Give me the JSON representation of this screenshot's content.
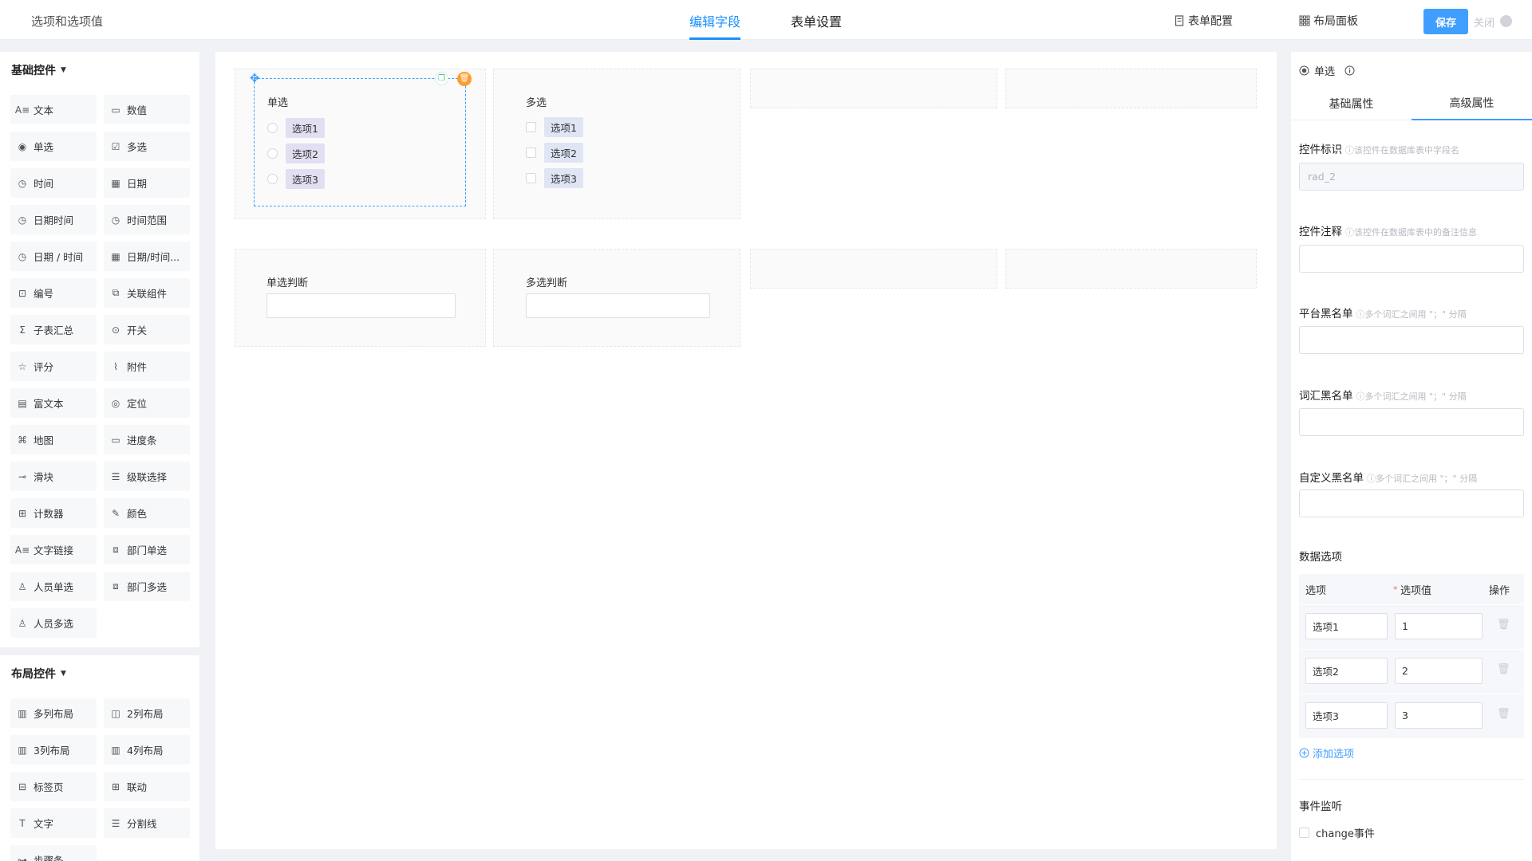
{
  "header": {
    "title": "选项和选项值",
    "tabs": [
      {
        "label": "编辑字段",
        "active": true
      },
      {
        "label": "表单设置",
        "active": false
      }
    ],
    "tools": [
      {
        "label": "表单配置",
        "icon": "form-config-icon"
      },
      {
        "label": "布局面板",
        "icon": "layout-panel-icon"
      }
    ],
    "save_label": "保存",
    "close_label": "关闭"
  },
  "left_panel": {
    "basic_group": {
      "title": "基础控件",
      "items": [
        {
          "label": "文本",
          "icon": "text-icon"
        },
        {
          "label": "数值",
          "icon": "number-icon"
        },
        {
          "label": "单选",
          "icon": "radio-icon"
        },
        {
          "label": "多选",
          "icon": "checkbox-icon"
        },
        {
          "label": "时间",
          "icon": "clock-icon"
        },
        {
          "label": "日期",
          "icon": "calendar-icon"
        },
        {
          "label": "日期时间",
          "icon": "clock-icon"
        },
        {
          "label": "时间范围",
          "icon": "clock-icon"
        },
        {
          "label": "日期 / 时间",
          "icon": "clock-icon"
        },
        {
          "label": "日期/时间...",
          "icon": "calendar-icon"
        },
        {
          "label": "编号",
          "icon": "serial-icon"
        },
        {
          "label": "关联组件",
          "icon": "link-component-icon"
        },
        {
          "label": "子表汇总",
          "icon": "sigma-icon"
        },
        {
          "label": "开关",
          "icon": "toggle-icon"
        },
        {
          "label": "评分",
          "icon": "star-icon"
        },
        {
          "label": "附件",
          "icon": "paperclip-icon"
        },
        {
          "label": "富文本",
          "icon": "rich-text-icon"
        },
        {
          "label": "定位",
          "icon": "location-icon"
        },
        {
          "label": "地图",
          "icon": "map-icon"
        },
        {
          "label": "进度条",
          "icon": "progress-icon"
        },
        {
          "label": "滑块",
          "icon": "slider-icon"
        },
        {
          "label": "级联选择",
          "icon": "cascader-icon"
        },
        {
          "label": "计数器",
          "icon": "counter-icon"
        },
        {
          "label": "颜色",
          "icon": "color-picker-icon"
        },
        {
          "label": "文字链接",
          "icon": "text-link-icon"
        },
        {
          "label": "部门单选",
          "icon": "department-icon"
        },
        {
          "label": "人员单选",
          "icon": "user-icon"
        },
        {
          "label": "部门多选",
          "icon": "department-multi-icon"
        },
        {
          "label": "人员多选",
          "icon": "users-icon"
        }
      ]
    },
    "layout_group": {
      "title": "布局控件",
      "items": [
        {
          "label": "多列布局",
          "icon": "columns-icon"
        },
        {
          "label": "2列布局",
          "icon": "two-columns-icon"
        },
        {
          "label": "3列布局",
          "icon": "three-columns-icon"
        },
        {
          "label": "4列布局",
          "icon": "four-columns-icon"
        },
        {
          "label": "标签页",
          "icon": "tabs-icon"
        },
        {
          "label": "联动",
          "icon": "linkage-icon"
        },
        {
          "label": "文字",
          "icon": "text-t-icon"
        },
        {
          "label": "分割线",
          "icon": "divider-icon"
        },
        {
          "label": "步骤条",
          "icon": "steps-icon"
        }
      ]
    }
  },
  "canvas": {
    "radio_field": {
      "label": "单选",
      "options": [
        "选项1",
        "选项2",
        "选项3"
      ]
    },
    "checkbox_field": {
      "label": "多选",
      "options": [
        "选项1",
        "选项2",
        "选项3"
      ]
    },
    "radio_judge": {
      "label": "单选判断"
    },
    "checkbox_judge": {
      "label": "多选判断"
    }
  },
  "right_panel": {
    "title": "单选",
    "tabs": [
      "基础属性",
      "高级属性"
    ],
    "active_tab": "高级属性",
    "fields": [
      {
        "label": "控件标识",
        "hint": "ⓘ该控件在数据库表中字段名",
        "value": "rad_2",
        "disabled": true
      },
      {
        "label": "控件注释",
        "hint": "ⓘ该控件在数据库表中的备注信息",
        "value": ""
      },
      {
        "label": "平台黑名单",
        "hint": "ⓘ多个词汇之间用 \"；\" 分隔",
        "value": ""
      },
      {
        "label": "词汇黑名单",
        "hint": "ⓘ多个词汇之间用 \"；\" 分隔",
        "value": ""
      },
      {
        "label": "自定义黑名单",
        "hint": "ⓘ多个词汇之间用 \"；\" 分隔",
        "value": ""
      }
    ],
    "data_options": {
      "title": "数据选项",
      "col_option": "选项",
      "col_value_required": "*",
      "col_value": "选项值",
      "col_action": "操作",
      "rows": [
        {
          "option": "选项1",
          "value": "1"
        },
        {
          "option": "选项2",
          "value": "2"
        },
        {
          "option": "选项3",
          "value": "3"
        }
      ],
      "add_label": "添加选项"
    },
    "events": {
      "title": "事件监听",
      "items": [
        {
          "label": "change事件",
          "checked": false
        }
      ]
    }
  }
}
